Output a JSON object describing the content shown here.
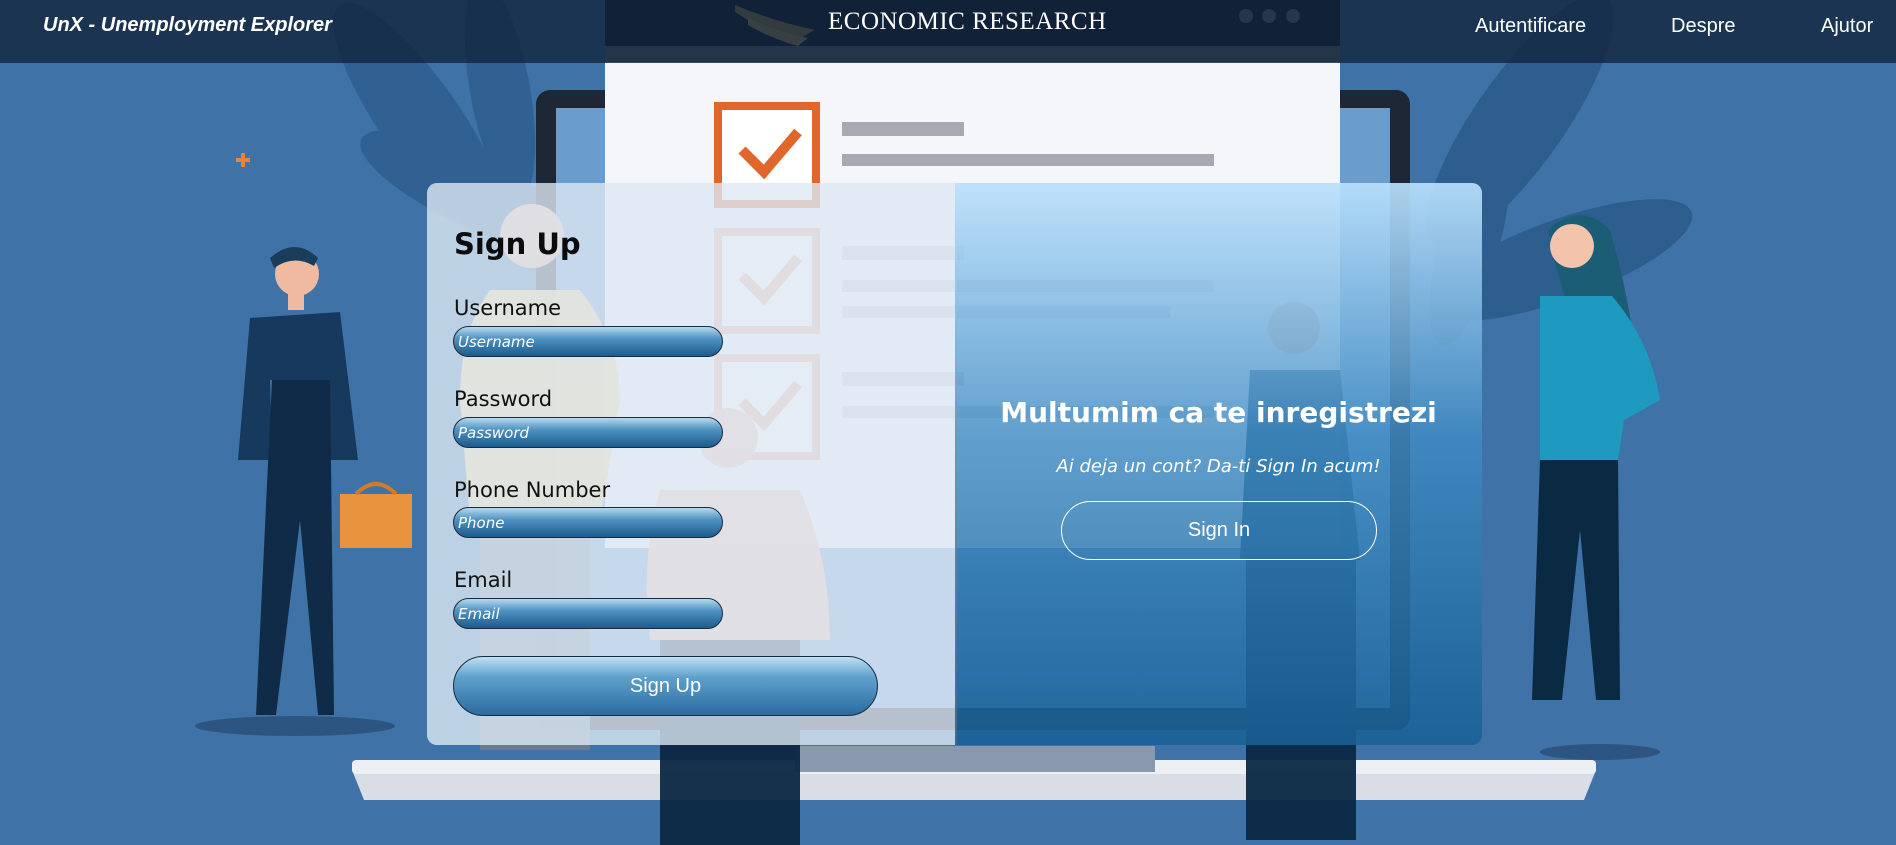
{
  "navbar": {
    "brand": "UnX - Unemployment Explorer",
    "links": [
      "Autentificare",
      "Despre",
      "Ajutor"
    ]
  },
  "banner": {
    "text": "ECONOMIC RESEARCH"
  },
  "signup_form": {
    "title": "Sign Up",
    "fields": [
      {
        "label": "Username",
        "placeholder": "Username",
        "value": ""
      },
      {
        "label": "Password",
        "placeholder": "Password",
        "value": ""
      },
      {
        "label": "Phone Number",
        "placeholder": "Phone",
        "value": ""
      },
      {
        "label": "Email",
        "placeholder": "Email",
        "value": ""
      }
    ],
    "submit_label": "Sign Up"
  },
  "signin_panel": {
    "title": "Multumim ca te inregistrezi",
    "subtitle": "Ai deja un cont? Da-ti Sign In acum!",
    "button_label": "Sign In"
  },
  "colors": {
    "background": "#3f73a8",
    "navbar": "#12263e",
    "accent_orange": "#e8833a",
    "button_blue": "#2a6ca0"
  }
}
